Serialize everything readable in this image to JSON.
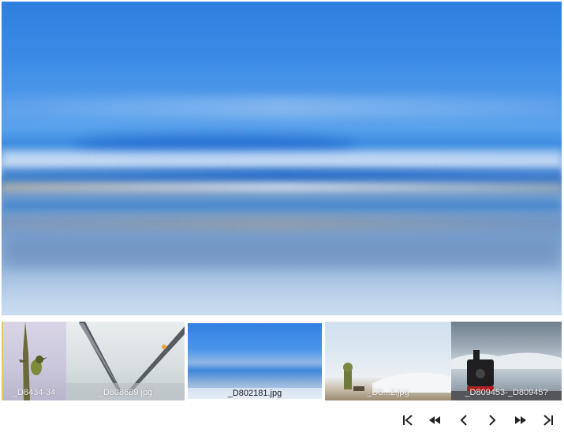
{
  "main_image": {
    "icon": "landscape-photo",
    "description_colors": [
      "#2f7fe0",
      "#8fb7e6",
      "#c7daf0"
    ]
  },
  "thumbnails": [
    {
      "caption": "_D8434-34",
      "state": "partial"
    },
    {
      "caption": "_D808689.jpg",
      "state": "normal"
    },
    {
      "caption": "_D802181.jpg",
      "state": "active"
    },
    {
      "caption": "_D8...2.jpg",
      "state": "normal"
    },
    {
      "caption": "_D809453-_D80945?",
      "state": "normal"
    }
  ],
  "controls": {
    "first": "first-icon",
    "prev_page": "rewind-icon",
    "prev": "chevron-left-icon",
    "next": "chevron-right-icon",
    "next_page": "fast-forward-icon",
    "last": "last-icon"
  }
}
